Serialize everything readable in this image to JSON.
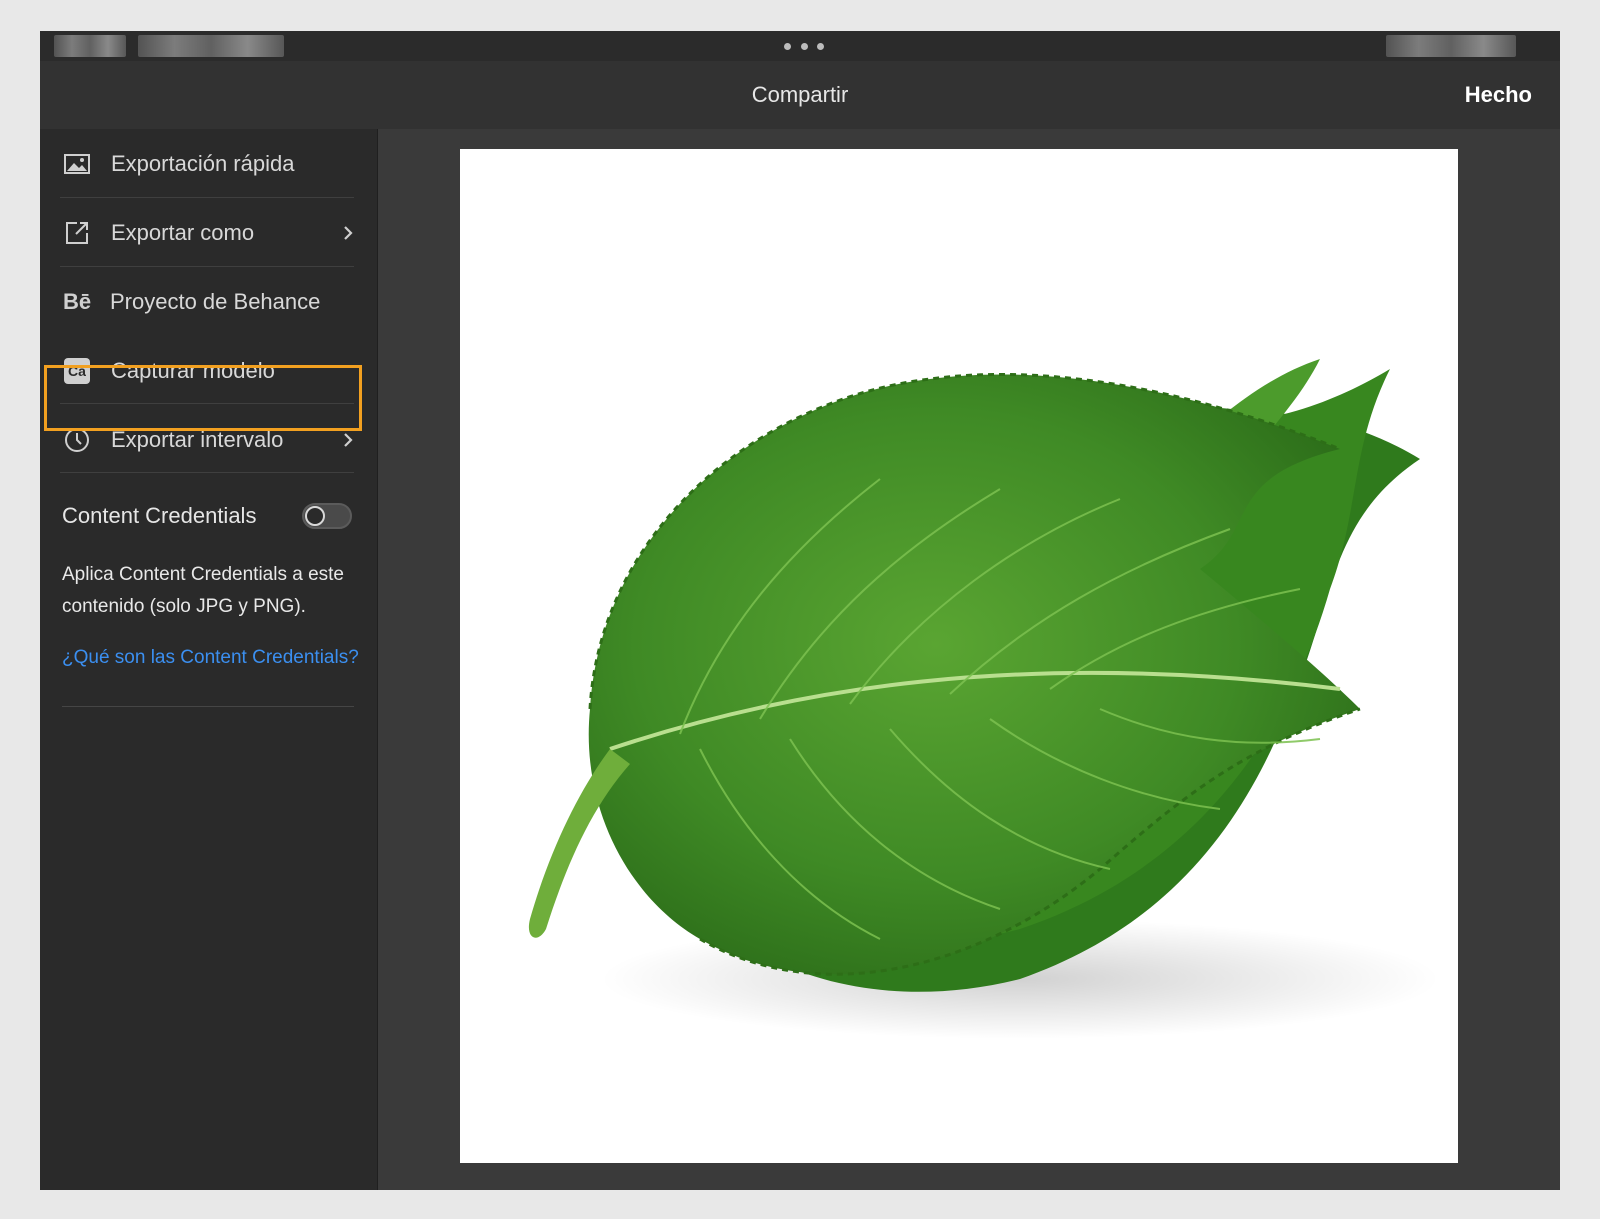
{
  "header": {
    "title": "Compartir",
    "done_label": "Hecho"
  },
  "sidebar": {
    "items": [
      {
        "label": "Exportación rápida",
        "icon": "image-icon",
        "has_chevron": false
      },
      {
        "label": "Exportar como",
        "icon": "export-icon",
        "has_chevron": true
      },
      {
        "label": "Proyecto de Behance",
        "icon": "behance-icon",
        "has_chevron": false,
        "highlighted": true,
        "icon_text": "Bē"
      },
      {
        "label": "Capturar modelo",
        "icon": "capture-icon",
        "has_chevron": false,
        "icon_text": "Ca"
      },
      {
        "label": "Exportar intervalo",
        "icon": "clock-icon",
        "has_chevron": true
      }
    ],
    "content_credentials": {
      "label": "Content Credentials",
      "enabled": false,
      "description": "Aplica Content Credentials a este contenido (solo JPG y PNG).",
      "link_text": "¿Qué son las Content Credentials?"
    }
  },
  "colors": {
    "highlight": "#f2a020",
    "link": "#3b8ff0",
    "leaf": "#3f8a25"
  },
  "preview": {
    "subject": "leaf-image"
  }
}
